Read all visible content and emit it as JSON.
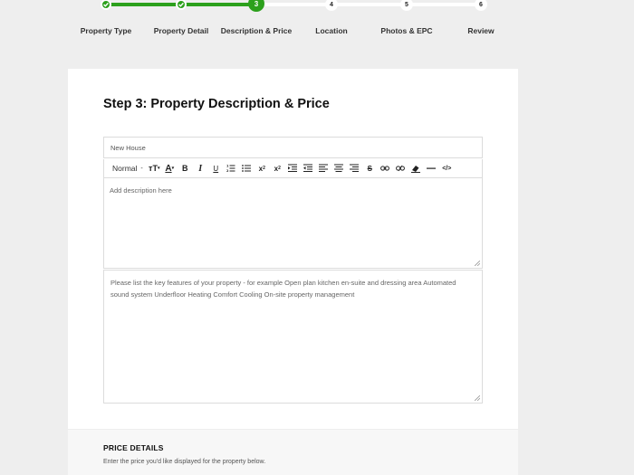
{
  "stepper": {
    "steps": [
      {
        "label": "Property Type",
        "state": "done"
      },
      {
        "label": "Property Detail",
        "state": "done"
      },
      {
        "label": "Description & Price",
        "state": "current",
        "number": "3"
      },
      {
        "label": "Location",
        "state": "todo",
        "number": "4"
      },
      {
        "label": "Photos & EPC",
        "state": "todo",
        "number": "5"
      },
      {
        "label": "Review",
        "state": "todo",
        "number": "6"
      }
    ],
    "accent_color": "#2ca01c"
  },
  "form": {
    "title": "Step 3: Property Description & Price",
    "name_value": "New House",
    "toolbar": {
      "format_label": "Normal",
      "buttons": [
        "font-size-icon",
        "font-color-icon",
        "bold-icon",
        "italic-icon",
        "underline-icon",
        "ordered-list-icon",
        "bullet-list-icon",
        "subscript-icon",
        "superscript-icon",
        "indent-icon",
        "outdent-icon",
        "align-left-icon",
        "align-center-icon",
        "align-right-icon",
        "strikethrough-icon",
        "link-icon",
        "unlink-icon",
        "eraser-icon",
        "horizontal-rule-icon",
        "code-icon"
      ]
    },
    "description_placeholder": "Add description here",
    "features_placeholder": "Please list the key features of your property - for example Open plan kitchen en-suite and dressing area Automated sound system Underfloor Heating Comfort Cooling On-site property management"
  },
  "price": {
    "heading": "PRICE DETAILS",
    "subtext": "Enter the price you'd like displayed for the property below."
  }
}
